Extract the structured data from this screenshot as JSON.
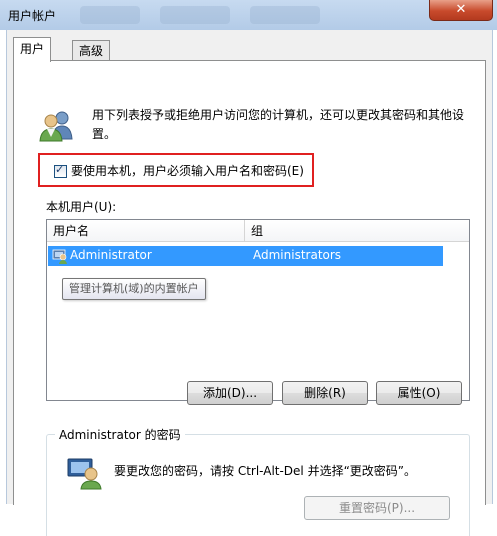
{
  "window": {
    "title": "用户帐户",
    "close_label": "✕"
  },
  "tabs": [
    {
      "label": "用户"
    },
    {
      "label": "高级"
    }
  ],
  "description": "用下列表授予或拒绝用户访问您的计算机，还可以更改其密码和其他设置。",
  "require_login": {
    "checked": true,
    "label": "要使用本机，用户必须输入用户名和密码(E)"
  },
  "users_section": {
    "label": "本机用户(U):",
    "columns": [
      "用户名",
      "组"
    ],
    "rows": [
      {
        "name": "Administrator",
        "group": "Administrators",
        "selected": true
      }
    ],
    "tooltip": "管理计算机(域)的内置帐户"
  },
  "buttons": {
    "add": "添加(D)...",
    "remove": "删除(R)",
    "properties": "属性(O)"
  },
  "password_group": {
    "title": "Administrator 的密码",
    "text": "要更改您的密码，请按 Ctrl-Alt-Del 并选择“更改密码”。",
    "reset_button": "重置密码(P)..."
  },
  "colors": {
    "selection": "#3399ff",
    "highlight_box": "#e02020",
    "close_button": "#c84a2c"
  },
  "icons": {
    "users": "users-icon",
    "user_row": "user-icon",
    "password": "password-key-icon",
    "checkbox": "checkmark-icon"
  }
}
